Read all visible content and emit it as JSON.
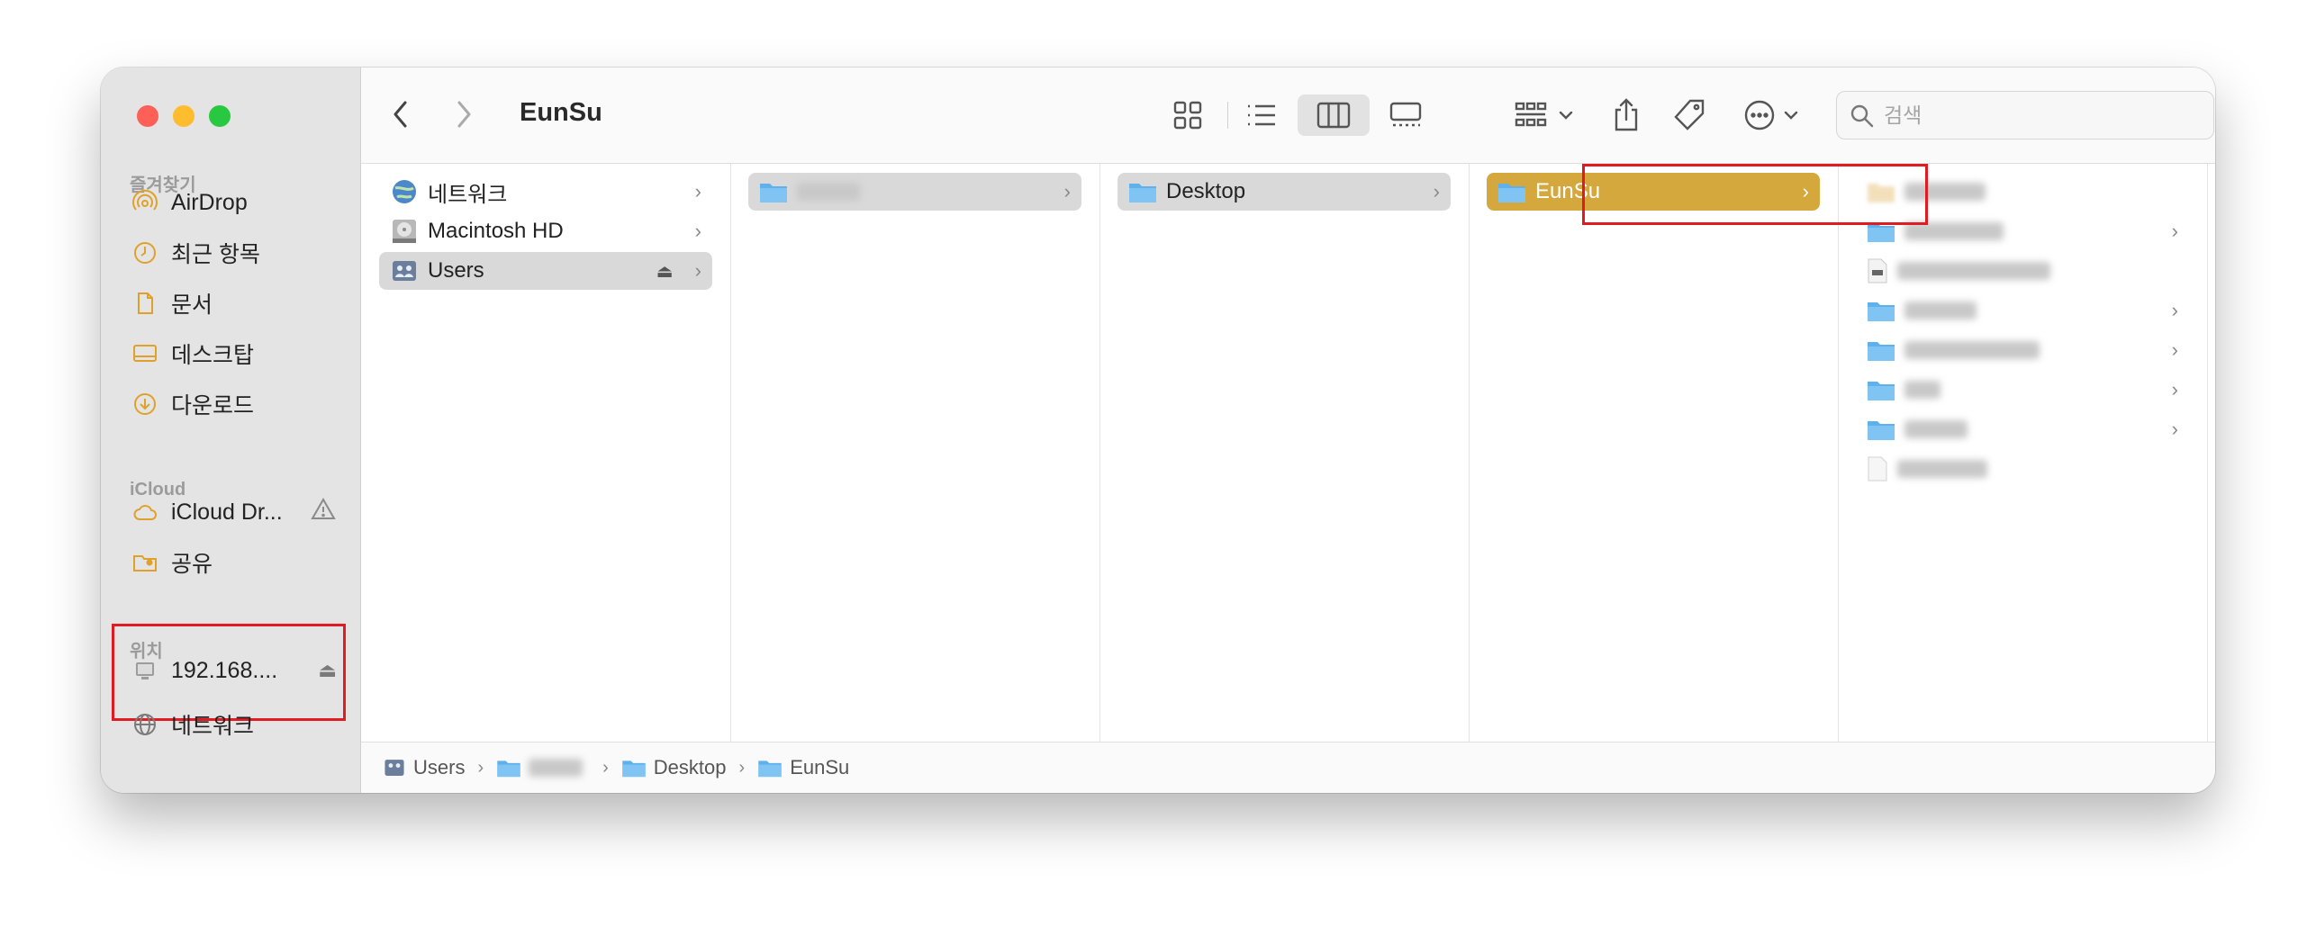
{
  "window": {
    "title": "EunSu"
  },
  "sidebar": {
    "favorites_header": "즐겨찾기",
    "favorites": [
      {
        "label": "AirDrop",
        "icon": "airdrop-icon"
      },
      {
        "label": "최근 항목",
        "icon": "clock-icon"
      },
      {
        "label": "문서",
        "icon": "document-icon"
      },
      {
        "label": "데스크탑",
        "icon": "desktop-icon"
      },
      {
        "label": "다운로드",
        "icon": "download-icon"
      }
    ],
    "icloud_header": "iCloud",
    "icloud": [
      {
        "label": "iCloud Dr...",
        "icon": "cloud-icon"
      },
      {
        "label": "공유",
        "icon": "shared-folder-icon"
      }
    ],
    "locations_header": "위치",
    "locations": [
      {
        "label": "192.168....",
        "icon": "server-icon"
      },
      {
        "label": "네트워크",
        "icon": "globe-icon"
      }
    ]
  },
  "toolbar": {
    "search_placeholder": "검색"
  },
  "columns": {
    "col1": [
      {
        "label": "네트워크",
        "icon": "network-icon"
      },
      {
        "label": "Macintosh HD",
        "icon": "harddisk-icon"
      },
      {
        "label": "Users",
        "icon": "users-drive-icon",
        "selected": true
      }
    ],
    "col3": [
      {
        "label": "Desktop"
      }
    ],
    "col4": [
      {
        "label": "EunSu"
      }
    ]
  },
  "pathbar": {
    "segments": [
      "Users",
      "",
      "Desktop",
      "EunSu"
    ]
  },
  "colors": {
    "selection_gold": "#d4a83c",
    "highlight_red": "#e11b22",
    "folder_blue": "#5eb1ea"
  }
}
